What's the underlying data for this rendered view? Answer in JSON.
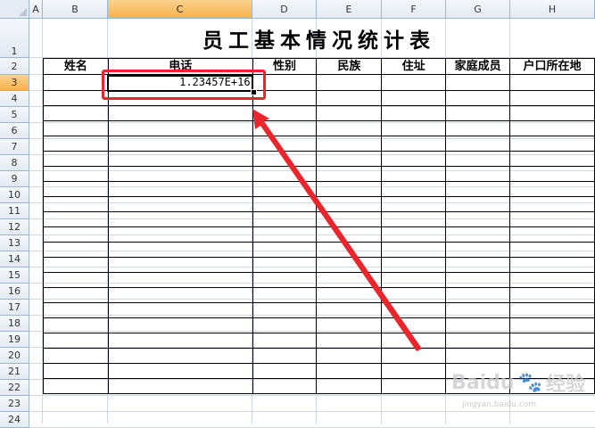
{
  "columns": [
    "A",
    "B",
    "C",
    "D",
    "E",
    "F",
    "G",
    "H"
  ],
  "rows": [
    "1",
    "2",
    "3",
    "4",
    "5",
    "6",
    "7",
    "8",
    "9",
    "10",
    "11",
    "12",
    "13",
    "14",
    "15",
    "16",
    "17",
    "18",
    "19",
    "20",
    "21",
    "22",
    "23",
    "24"
  ],
  "active_cell": {
    "column": "C",
    "row": "3"
  },
  "title": "员工基本情况统计表",
  "headers": [
    "姓名",
    "电话",
    "性别",
    "民族",
    "住址",
    "家庭成员",
    "户口所在地"
  ],
  "data_row": [
    "",
    "1.23457E+16",
    "",
    "",
    "",
    "",
    ""
  ],
  "empty_row_count": 20,
  "colors": {
    "annotation": "#e8262c",
    "active_header": "#f7b34d",
    "header_bg": "#e4eaf3",
    "gridline": "#d0d7e5"
  },
  "icons": {
    "corner": "select-all-triangle-icon",
    "fill_handle": "fill-handle-icon"
  },
  "watermark": {
    "brand": "Baidu",
    "suffix": "经验",
    "url": "jingyan.baidu.com"
  }
}
